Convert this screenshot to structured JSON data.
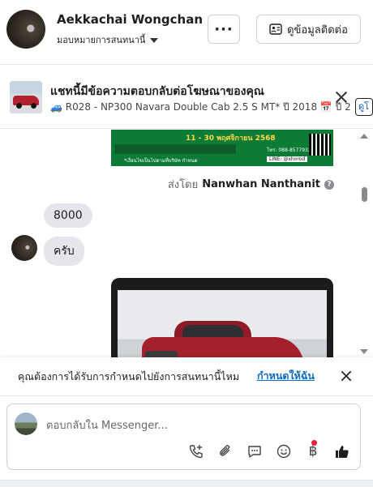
{
  "header": {
    "contact_name": "Aekkachai Wongchan",
    "assign_label": "มอบหมายการสนทนานี้",
    "more_label": "···",
    "contact_info_label": "ดูข้อมูลติดต่อ"
  },
  "ad_banner": {
    "title": "แชทนี้มีข้อความตอบกลับต่อโฆษณาของคุณ",
    "subtitle": "🚙 R028 - NP300 Navara Double Cab 2.5 S MT* ปี 2018 📅 ปี 201...",
    "tab_label": "ดูโ"
  },
  "promo_image": {
    "dates": "11 - 30 พฤศจิกายน 2568",
    "tel": "โทร: 088-8577932",
    "line": "LINE: @xhorod",
    "caption": "*เงื่อนไขเป็นไปตามที่บริษัท กำหนด"
  },
  "messages": {
    "sent_by_prefix": "ส่งโดย",
    "sent_by_name": "Nanwhan Nanthanit",
    "bubble_1": "8000",
    "bubble_2": "ครับ"
  },
  "notice": {
    "text": "คุณต้องการได้รับการกำหนดไปยังการสนทนานี้ไหม",
    "link": "กำหนดให้ฉัน"
  },
  "composer": {
    "placeholder": "ตอบกลับใน Messenger..."
  },
  "icons": {
    "call": "phone-plus-icon",
    "attach": "paperclip-icon",
    "saved_reply": "chat-bubble-icon",
    "emoji": "smiley-icon",
    "payment": "baht-icon",
    "like": "thumbs-up-icon"
  },
  "colors": {
    "link": "#0a6bc2",
    "like": "#1c1e21",
    "notification_dot": "#e41e3f",
    "bubble": "#e4e6eb"
  }
}
